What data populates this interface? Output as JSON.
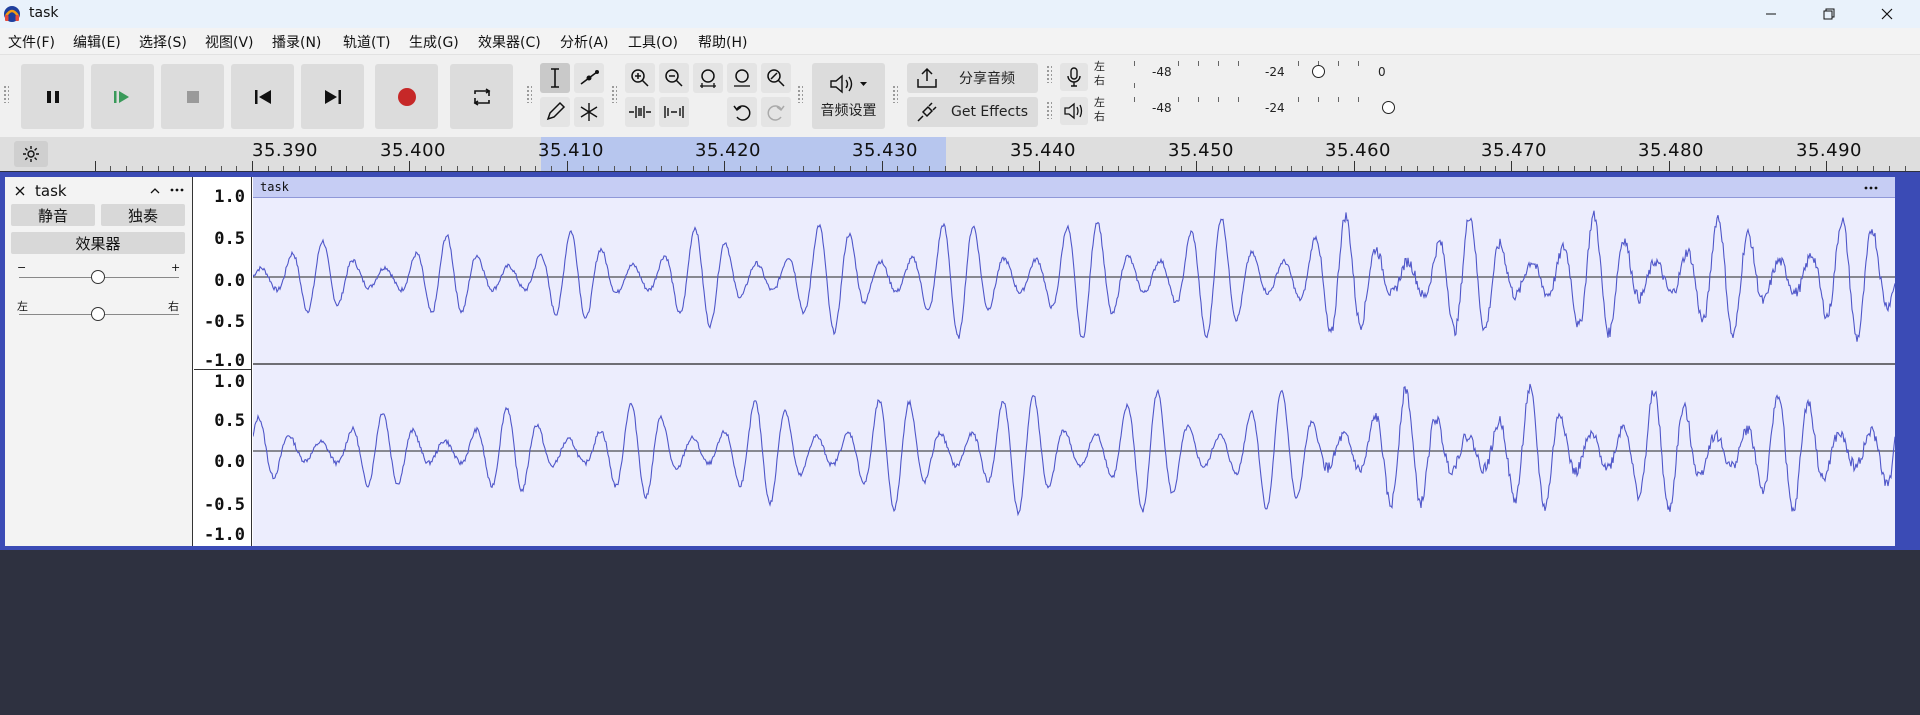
{
  "window": {
    "title": "task"
  },
  "menu": [
    "文件(F)",
    "编辑(E)",
    "选择(S)",
    "视图(V)",
    "播录(N)",
    "轨道(T)",
    "生成(G)",
    "效果器(C)",
    "分析(A)",
    "工具(O)",
    "帮助(H)"
  ],
  "toolbar": {
    "audio_settings_label": "音频设置",
    "share_audio_label": "分享音频",
    "get_effects_label": "Get Effects"
  },
  "meters": {
    "channel_top": "左",
    "channel_bottom": "右",
    "record": {
      "labels": [
        "-48",
        "-24",
        "0"
      ]
    },
    "playback": {
      "labels": [
        "-48",
        "-24"
      ]
    }
  },
  "ruler": {
    "labels": [
      "35.390",
      "35.400",
      "35.410",
      "35.420",
      "35.430",
      "35.440",
      "35.450",
      "35.460",
      "35.470",
      "35.480",
      "35.490"
    ]
  },
  "track": {
    "name": "task",
    "mute_label": "静音",
    "solo_label": "独奏",
    "effects_label": "效果器",
    "gain_minus": "−",
    "gain_plus": "+",
    "pan_left": "左",
    "pan_right": "右",
    "clip_name": "task",
    "scale_labels": [
      "1.0",
      "0.5",
      "0.0",
      "-0.5",
      "-1.0"
    ]
  },
  "colors": {
    "selection": "#b7c6ee",
    "waveform": "#4f56c9",
    "track_border": "#3b4bb5",
    "record_red": "#c62828",
    "play_green": "#3a9a5a"
  }
}
